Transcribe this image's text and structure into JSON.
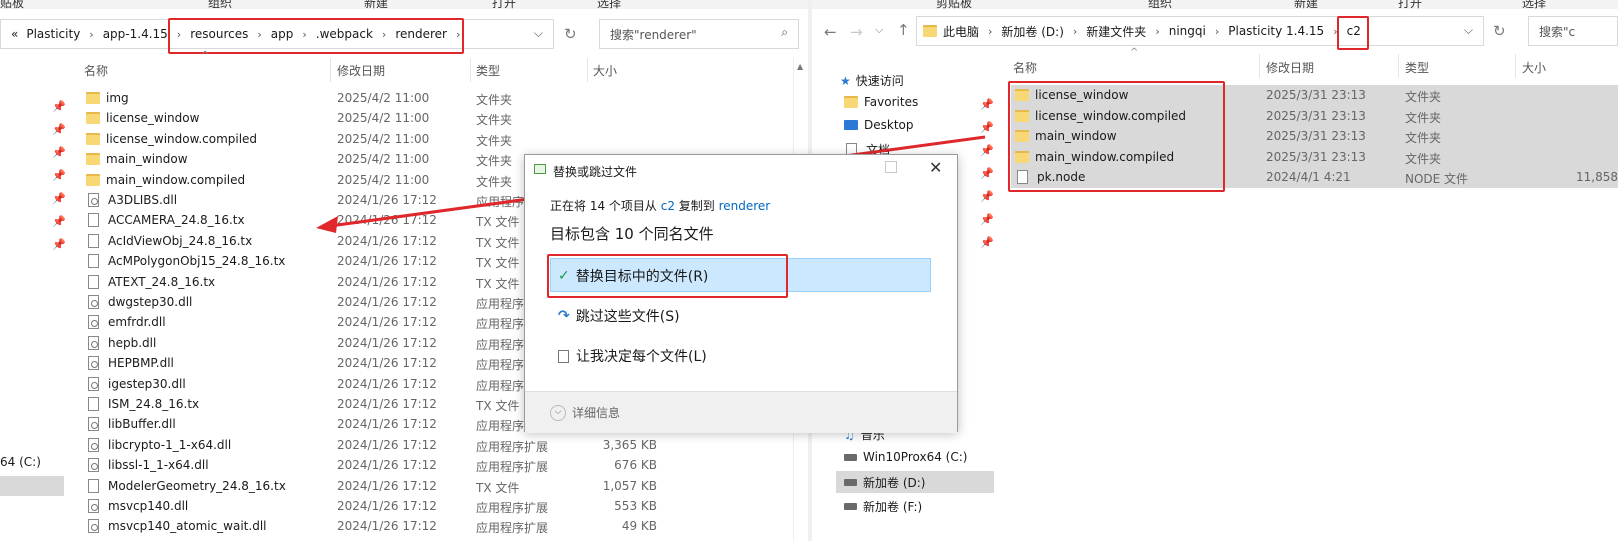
{
  "ribbon": {
    "left": [
      "贴板",
      "组织",
      "新建",
      "打开",
      "选择"
    ],
    "right": [
      "剪贴板",
      "组织",
      "新建",
      "打开",
      "选择"
    ]
  },
  "left_window": {
    "breadcrumb_lead": "«",
    "breadcrumb": [
      "Plasticity",
      "app-1.4.15",
      "resources",
      "app",
      ".webpack",
      "renderer"
    ],
    "search_placeholder": "搜索\"renderer\"",
    "columns": {
      "name": "名称",
      "date": "修改日期",
      "type": "类型",
      "size": "大小"
    },
    "nav_drive": "64 (C:)",
    "files": [
      {
        "name": "img",
        "date": "2025/4/2 11:00",
        "type": "文件夹",
        "size": "",
        "kind": "folder"
      },
      {
        "name": "license_window",
        "date": "2025/4/2 11:00",
        "type": "文件夹",
        "size": "",
        "kind": "folder"
      },
      {
        "name": "license_window.compiled",
        "date": "2025/4/2 11:00",
        "type": "文件夹",
        "size": "",
        "kind": "folder"
      },
      {
        "name": "main_window",
        "date": "2025/4/2 11:00",
        "type": "文件夹",
        "size": "",
        "kind": "folder"
      },
      {
        "name": "main_window.compiled",
        "date": "2025/4/2 11:00",
        "type": "文件夹",
        "size": "",
        "kind": "folder"
      },
      {
        "name": "A3DLIBS.dll",
        "date": "2024/1/26 17:12",
        "type": "应用程序",
        "size": "",
        "kind": "dll"
      },
      {
        "name": "ACCAMERA_24.8_16.tx",
        "date": "2024/1/26 17:12",
        "type": "TX 文件",
        "size": "",
        "kind": "doc"
      },
      {
        "name": "AcIdViewObj_24.8_16.tx",
        "date": "2024/1/26 17:12",
        "type": "TX 文件",
        "size": "",
        "kind": "doc"
      },
      {
        "name": "AcMPolygonObj15_24.8_16.tx",
        "date": "2024/1/26 17:12",
        "type": "TX 文件",
        "size": "",
        "kind": "doc"
      },
      {
        "name": "ATEXT_24.8_16.tx",
        "date": "2024/1/26 17:12",
        "type": "TX 文件",
        "size": "",
        "kind": "doc"
      },
      {
        "name": "dwgstep30.dll",
        "date": "2024/1/26 17:12",
        "type": "应用程序",
        "size": "",
        "kind": "dll"
      },
      {
        "name": "emfrdr.dll",
        "date": "2024/1/26 17:12",
        "type": "应用程序",
        "size": "",
        "kind": "dll"
      },
      {
        "name": "hepb.dll",
        "date": "2024/1/26 17:12",
        "type": "应用程序",
        "size": "",
        "kind": "dll"
      },
      {
        "name": "HEPBMP.dll",
        "date": "2024/1/26 17:12",
        "type": "应用程序",
        "size": "",
        "kind": "dll"
      },
      {
        "name": "igestep30.dll",
        "date": "2024/1/26 17:12",
        "type": "应用程序",
        "size": "",
        "kind": "dll"
      },
      {
        "name": "ISM_24.8_16.tx",
        "date": "2024/1/26 17:12",
        "type": "TX 文件",
        "size": "",
        "kind": "doc"
      },
      {
        "name": "libBuffer.dll",
        "date": "2024/1/26 17:12",
        "type": "应用程序",
        "size": "",
        "kind": "dll"
      },
      {
        "name": "libcrypto-1_1-x64.dll",
        "date": "2024/1/26 17:12",
        "type": "应用程序扩展",
        "size": "3,365 KB",
        "kind": "dll"
      },
      {
        "name": "libssl-1_1-x64.dll",
        "date": "2024/1/26 17:12",
        "type": "应用程序扩展",
        "size": "676 KB",
        "kind": "dll"
      },
      {
        "name": "ModelerGeometry_24.8_16.tx",
        "date": "2024/1/26 17:12",
        "type": "TX 文件",
        "size": "1,057 KB",
        "kind": "doc"
      },
      {
        "name": "msvcp140.dll",
        "date": "2024/1/26 17:12",
        "type": "应用程序扩展",
        "size": "553 KB",
        "kind": "dll"
      },
      {
        "name": "msvcp140_atomic_wait.dll",
        "date": "2024/1/26 17:12",
        "type": "应用程序扩展",
        "size": "49 KB",
        "kind": "dll"
      }
    ]
  },
  "right_window": {
    "breadcrumb": [
      "此电脑",
      "新加卷 (D:)",
      "新建文件夹",
      "ningqi",
      "Plasticity 1.4.15",
      "c2"
    ],
    "search_placeholder": "搜索\"c",
    "columns": {
      "name": "名称",
      "date": "修改日期",
      "type": "类型",
      "size": "大小"
    },
    "nav": {
      "quick_access": "快速访问",
      "items": [
        "Favorites",
        "Desktop",
        "文档"
      ],
      "bottom": [
        "音乐",
        "Win10Prox64 (C:)",
        "新加卷 (D:)",
        "新加卷 (F:)"
      ]
    },
    "files": [
      {
        "name": "license_window",
        "date": "2025/3/31 23:13",
        "type": "文件夹",
        "size": "",
        "kind": "folder"
      },
      {
        "name": "license_window.compiled",
        "date": "2025/3/31 23:13",
        "type": "文件夹",
        "size": "",
        "kind": "folder"
      },
      {
        "name": "main_window",
        "date": "2025/3/31 23:13",
        "type": "文件夹",
        "size": "",
        "kind": "folder"
      },
      {
        "name": "main_window.compiled",
        "date": "2025/3/31 23:13",
        "type": "文件夹",
        "size": "",
        "kind": "folder"
      },
      {
        "name": "pk.node",
        "date": "2024/4/1 4:21",
        "type": "NODE 文件",
        "size": "11,858",
        "kind": "doc"
      }
    ]
  },
  "dialog": {
    "title": "替换或跳过文件",
    "line_prefix": "正在将 14 个项目从 ",
    "source": "c2",
    "line_mid": " 复制到 ",
    "target": "renderer",
    "heading": "目标包含 10 个同名文件",
    "opt_replace": "替换目标中的文件(R)",
    "opt_skip": "跳过这些文件(S)",
    "opt_decide": "让我决定每个文件(L)",
    "details": "详细信息"
  },
  "colors": {
    "highlight": "#e0282c",
    "accent": "#0067c0",
    "selected": "#cce8ff"
  }
}
